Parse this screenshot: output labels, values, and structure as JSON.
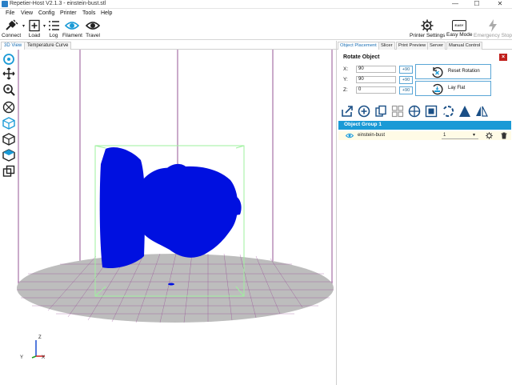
{
  "window": {
    "title": "Repetier-Host V2.1.3 - einstein-bust.stl",
    "minimize": "—",
    "maximize": "☐",
    "close": "✕"
  },
  "menu": [
    "File",
    "View",
    "Config",
    "Printer",
    "Tools",
    "Help"
  ],
  "toolbar": {
    "connect": "Connect",
    "load": "Load",
    "log": "Log",
    "filament": "Filament",
    "travel": "Travel",
    "printer_settings": "Printer Settings",
    "easy_mode": "Easy Mode",
    "easy_badge": "EASY",
    "emergency_stop": "Emergency Stop"
  },
  "view_tabs": [
    "3D View",
    "Temperature Curve"
  ],
  "panel_tabs": [
    "Object Placement",
    "Slicer",
    "Print Preview",
    "Server",
    "Manual Control"
  ],
  "rotate": {
    "title": "Rotate Object",
    "x_label": "X:",
    "x_value": "90",
    "y_label": "Y:",
    "y_value": "90",
    "z_label": "Z:",
    "z_value": "0",
    "plus90": "+90",
    "reset_rotation": "Reset Rotation",
    "lay_flat": "Lay Flat",
    "close": "×"
  },
  "object_group": {
    "title": "Object Group 1",
    "items": [
      {
        "name": "einstein-bust",
        "count": "1"
      }
    ]
  },
  "axes": {
    "y": "Y",
    "z": "Z",
    "x": "X"
  },
  "colors": {
    "accent": "#1a9ad6",
    "model": "#0010e0",
    "bed": "#bdbdbd",
    "grid": "#8a2e8a",
    "bbox": "#9ef19e",
    "close_red": "#c0201c"
  }
}
